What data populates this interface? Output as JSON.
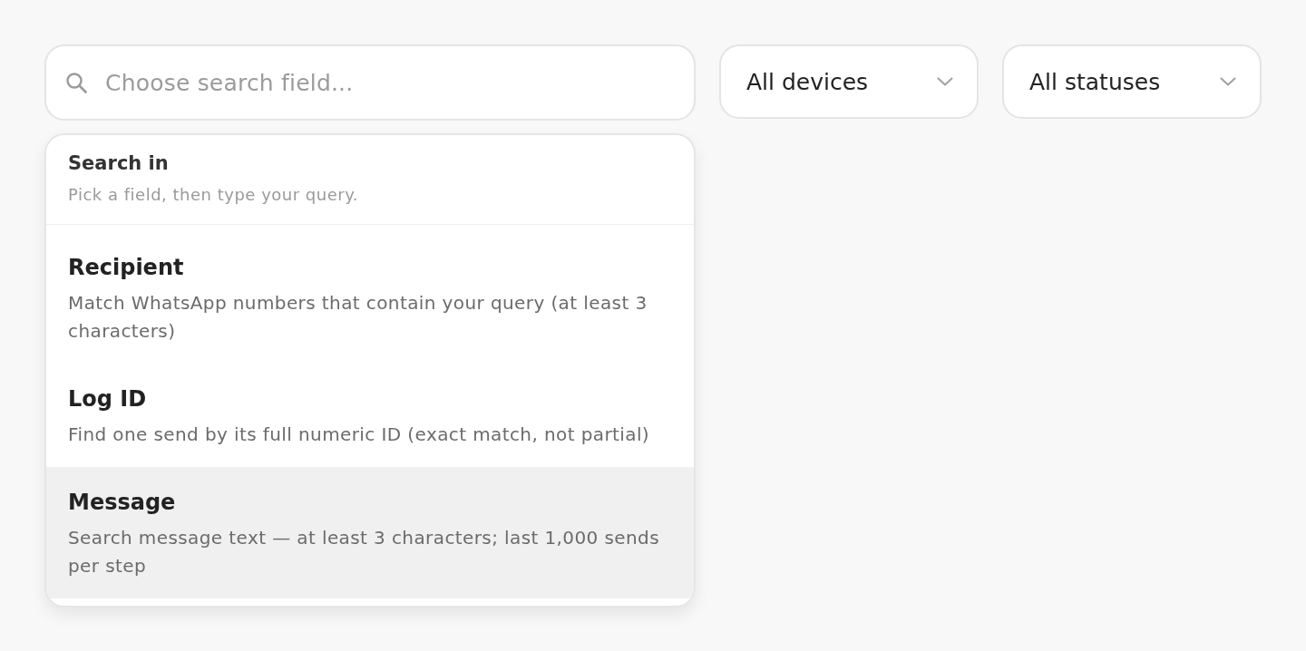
{
  "search": {
    "placeholder": "Choose search field..."
  },
  "filters": [
    {
      "value": "All devices"
    },
    {
      "value": "All statuses"
    }
  ],
  "search_menu": {
    "title": "Search in",
    "subtitle": "Pick a field, then type your query.",
    "options": [
      {
        "label": "Recipient",
        "description": "Match WhatsApp numbers that contain your query (at least 3 characters)",
        "selected": false
      },
      {
        "label": "Log ID",
        "description": "Find one send by its full numeric ID (exact match, not partial)",
        "selected": false
      },
      {
        "label": "Message",
        "description": "Search message text — at least 3 characters; last 1,000 sends per step",
        "selected": true
      }
    ]
  }
}
